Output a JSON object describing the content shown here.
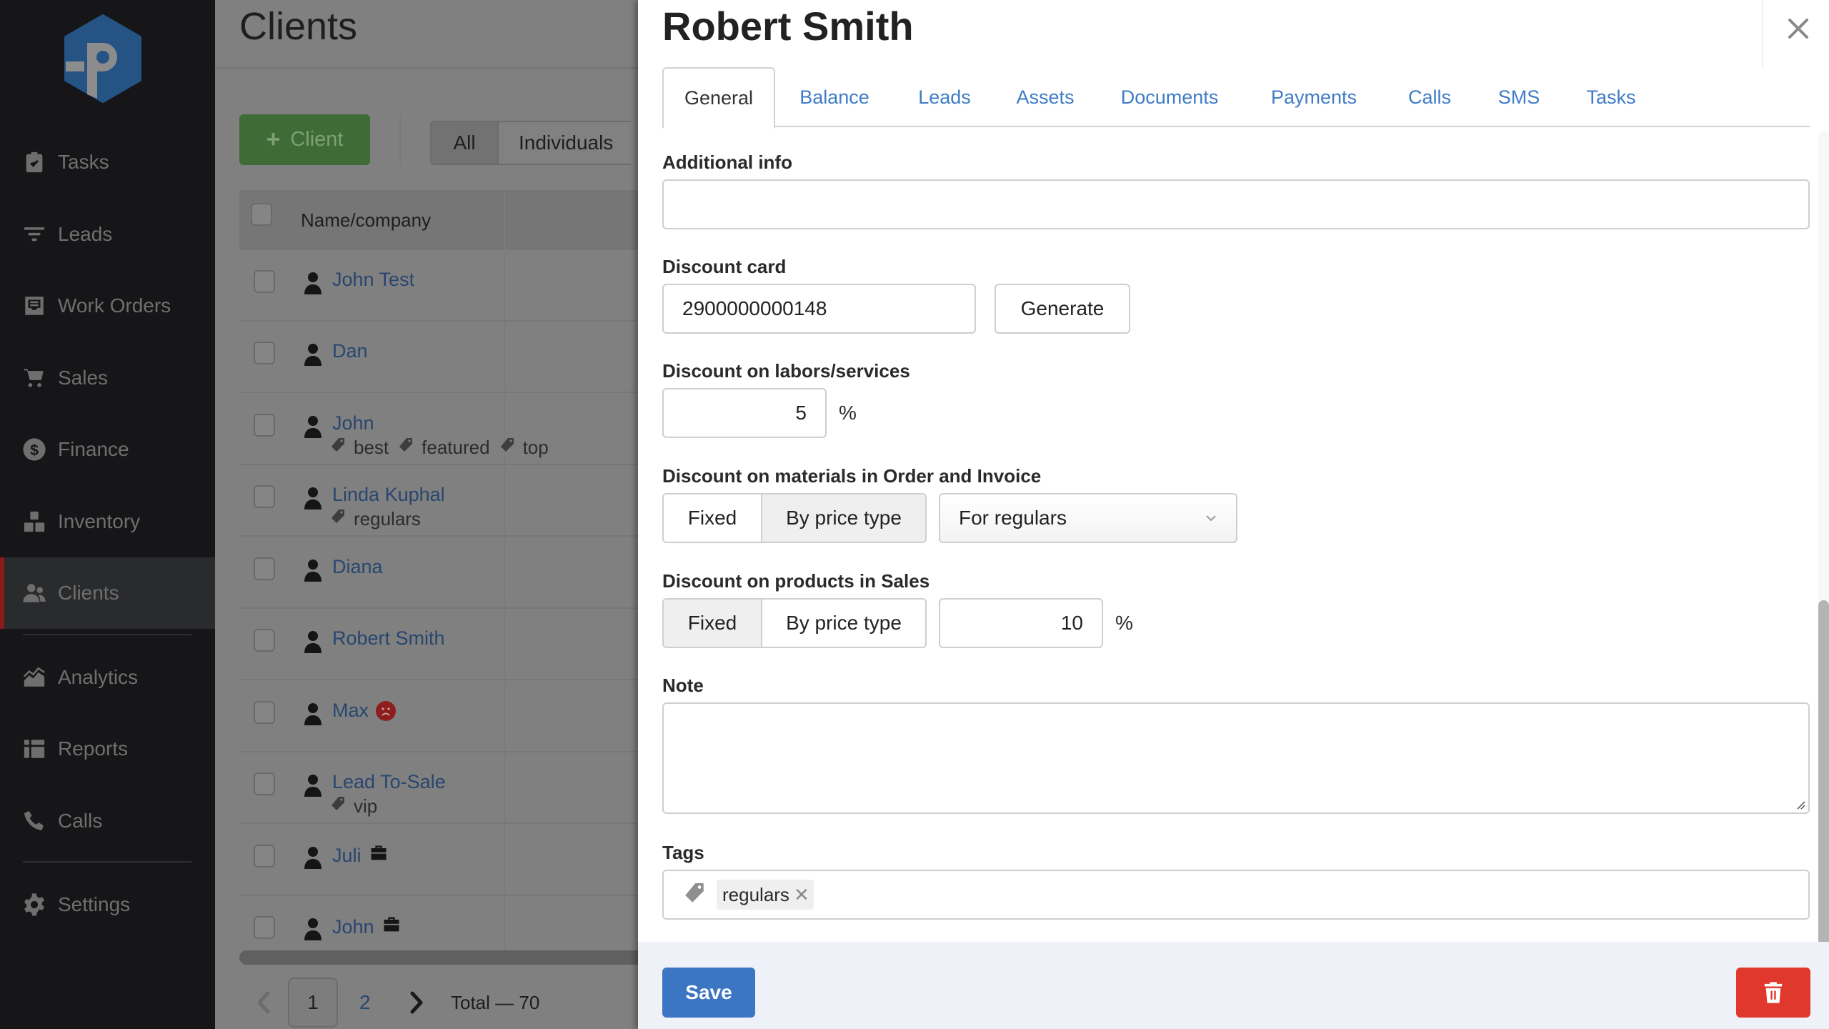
{
  "app": {
    "logo_letter": "P"
  },
  "sidebar": {
    "items": [
      {
        "label": "Tasks",
        "icon": "clipboard-check-icon"
      },
      {
        "label": "Leads",
        "icon": "funnel-icon"
      },
      {
        "label": "Work Orders",
        "icon": "inbox-tray-icon"
      },
      {
        "label": "Sales",
        "icon": "cart-icon"
      },
      {
        "label": "Finance",
        "icon": "dollar-circle-icon"
      },
      {
        "label": "Inventory",
        "icon": "boxes-icon"
      },
      {
        "label": "Clients",
        "icon": "users-icon",
        "active": true
      },
      {
        "label": "Analytics",
        "icon": "area-chart-icon"
      },
      {
        "label": "Reports",
        "icon": "table-icon"
      },
      {
        "label": "Calls",
        "icon": "phone-icon"
      },
      {
        "label": "Settings",
        "icon": "gear-icon"
      }
    ]
  },
  "clients_page": {
    "title": "Clients",
    "add_button": {
      "icon": "+",
      "label": "Client"
    },
    "filters": [
      "All",
      "Individuals"
    ],
    "active_filter": "All",
    "table": {
      "column_header": "Name/company",
      "rows": [
        {
          "name": "John Test",
          "tags": []
        },
        {
          "name": "Dan",
          "tags": []
        },
        {
          "name": "John",
          "tags": [
            "best",
            "featured",
            "top"
          ]
        },
        {
          "name": "Linda Kuphal",
          "tags": [
            "regulars"
          ]
        },
        {
          "name": "Diana",
          "tags": []
        },
        {
          "name": "Robert Smith",
          "tags": []
        },
        {
          "name": "Max",
          "tags": [],
          "badge": "sad-face-icon"
        },
        {
          "name": "Lead To-Sale",
          "tags": [
            "vip"
          ]
        },
        {
          "name": "Juli",
          "tags": [],
          "badge": "briefcase-icon"
        },
        {
          "name": "John",
          "tags": [],
          "badge": "briefcase-icon"
        }
      ]
    },
    "pagination": {
      "pages": [
        "1",
        "2"
      ],
      "current": "1",
      "total_label": "Total — 70"
    }
  },
  "drawer": {
    "title": "Robert Smith",
    "tabs": [
      "General",
      "Balance",
      "Leads",
      "Assets",
      "Documents",
      "Payments",
      "Calls",
      "SMS",
      "Tasks"
    ],
    "active_tab": "General",
    "fields": {
      "additional_info": {
        "label": "Additional info",
        "value": ""
      },
      "discount_card": {
        "label": "Discount card",
        "value": "2900000000148",
        "generate_label": "Generate"
      },
      "discount_labors": {
        "label": "Discount on labors/services",
        "value": "5",
        "unit": "%"
      },
      "discount_materials": {
        "label": "Discount on materials in Order and Invoice",
        "options": [
          "Fixed",
          "By price type"
        ],
        "selected_option": "By price type",
        "price_type_value": "For regulars"
      },
      "discount_products": {
        "label": "Discount on products in Sales",
        "options": [
          "Fixed",
          "By price type"
        ],
        "selected_option": "Fixed",
        "value": "10",
        "unit": "%"
      },
      "note": {
        "label": "Note",
        "value": ""
      },
      "tags": {
        "label": "Tags",
        "items": [
          "regulars"
        ],
        "remove_glyph": "✕"
      }
    },
    "footer": {
      "save_label": "Save",
      "delete_icon": "trash-icon"
    },
    "colors": {
      "save": "#3c75c1",
      "delete": "#e0382c",
      "tab_link": "#3f7cc7"
    }
  }
}
